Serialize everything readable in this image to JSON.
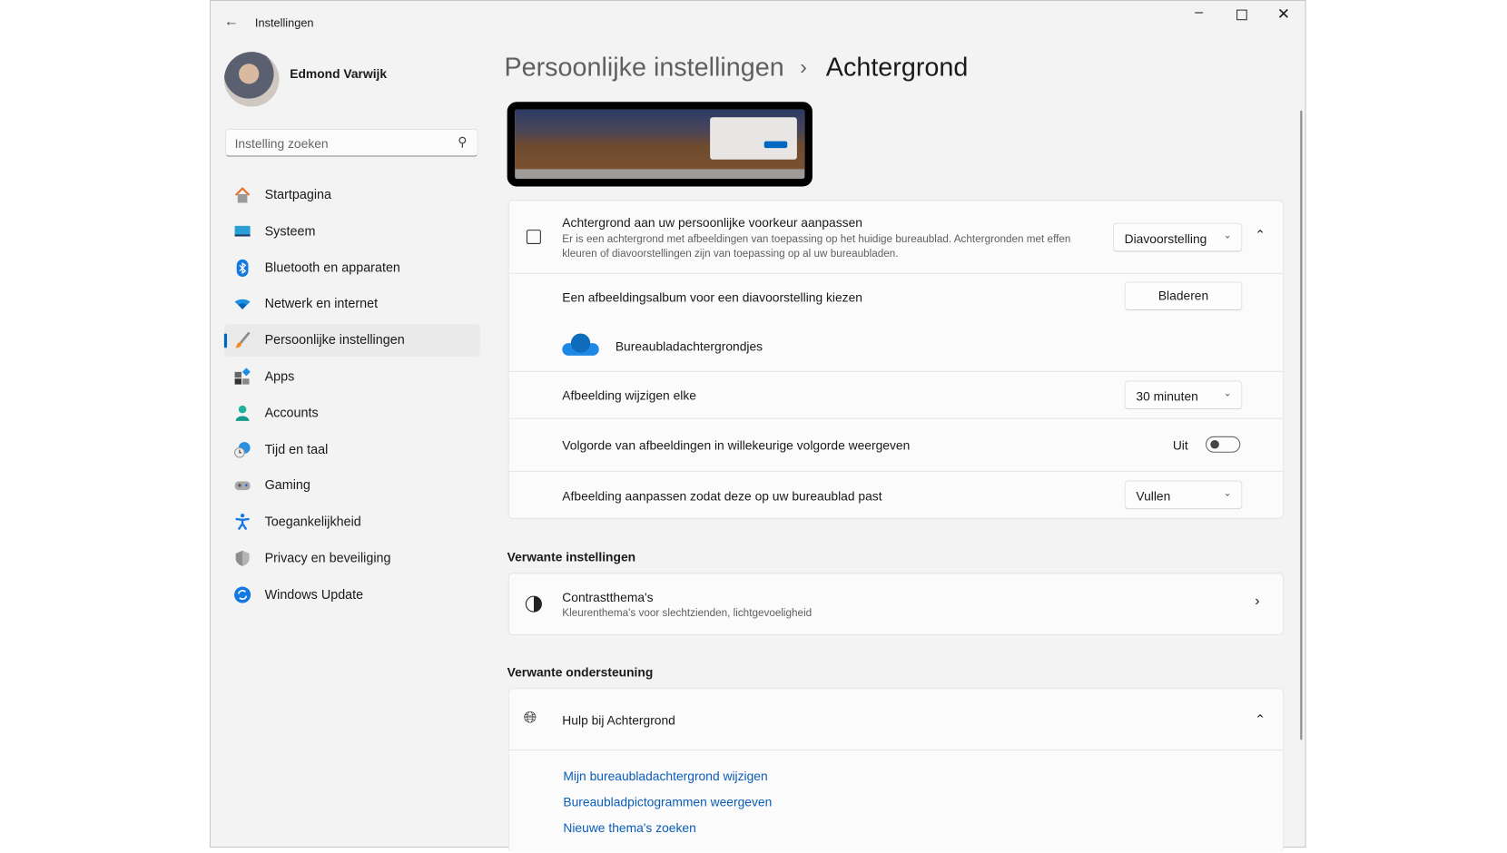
{
  "window": {
    "title": "Instellingen"
  },
  "user": {
    "name": "Edmond Varwijk"
  },
  "search": {
    "placeholder": "Instelling zoeken"
  },
  "nav": [
    {
      "label": "Startpagina",
      "icon": "home-icon"
    },
    {
      "label": "Systeem",
      "icon": "system-icon"
    },
    {
      "label": "Bluetooth en apparaten",
      "icon": "bluetooth-icon"
    },
    {
      "label": "Netwerk en internet",
      "icon": "wifi-icon"
    },
    {
      "label": "Persoonlijke instellingen",
      "icon": "brush-icon",
      "selected": true
    },
    {
      "label": "Apps",
      "icon": "apps-icon"
    },
    {
      "label": "Accounts",
      "icon": "account-icon"
    },
    {
      "label": "Tijd en taal",
      "icon": "clock-globe-icon"
    },
    {
      "label": "Gaming",
      "icon": "gamepad-icon"
    },
    {
      "label": "Toegankelijkheid",
      "icon": "accessibility-icon"
    },
    {
      "label": "Privacy en beveiliging",
      "icon": "shield-icon"
    },
    {
      "label": "Windows Update",
      "icon": "update-icon"
    }
  ],
  "breadcrumb": {
    "parent": "Persoonlijke instellingen",
    "separator": "›",
    "current": "Achtergrond"
  },
  "background": {
    "title": "Achtergrond aan uw persoonlijke voorkeur aanpassen",
    "description": "Er is een achtergrond met afbeeldingen van toepassing op het huidige bureaublad. Achtergronden met effen kleuren of diavoorstellingen zijn van toepassing op al uw bureaubladen.",
    "type_value": "Diavoorstelling",
    "album_label": "Een afbeeldingsalbum voor een diavoorstelling kiezen",
    "browse_label": "Bladeren",
    "album_name": "Bureaubladachtergrondjes",
    "interval_label": "Afbeelding wijzigen elke",
    "interval_value": "30 minuten",
    "shuffle_label": "Volgorde van afbeeldingen in willekeurige volgorde weergeven",
    "shuffle_state": "Uit",
    "fit_label": "Afbeelding aanpassen zodat deze op uw bureaublad past",
    "fit_value": "Vullen"
  },
  "related": {
    "heading": "Verwante instellingen",
    "contrast_title": "Contrastthema's",
    "contrast_desc": "Kleurenthema's voor slechtzienden, lichtgevoeligheid"
  },
  "support": {
    "heading": "Verwante ondersteuning",
    "help_title": "Hulp bij Achtergrond",
    "links": [
      "Mijn bureaubladachtergrond wijzigen",
      "Bureaubladpictogrammen weergeven",
      "Nieuwe thema's zoeken"
    ]
  },
  "colors": {
    "accent": "#0067c0",
    "link": "#0a5db8",
    "window_bg": "#f3f3f3"
  }
}
